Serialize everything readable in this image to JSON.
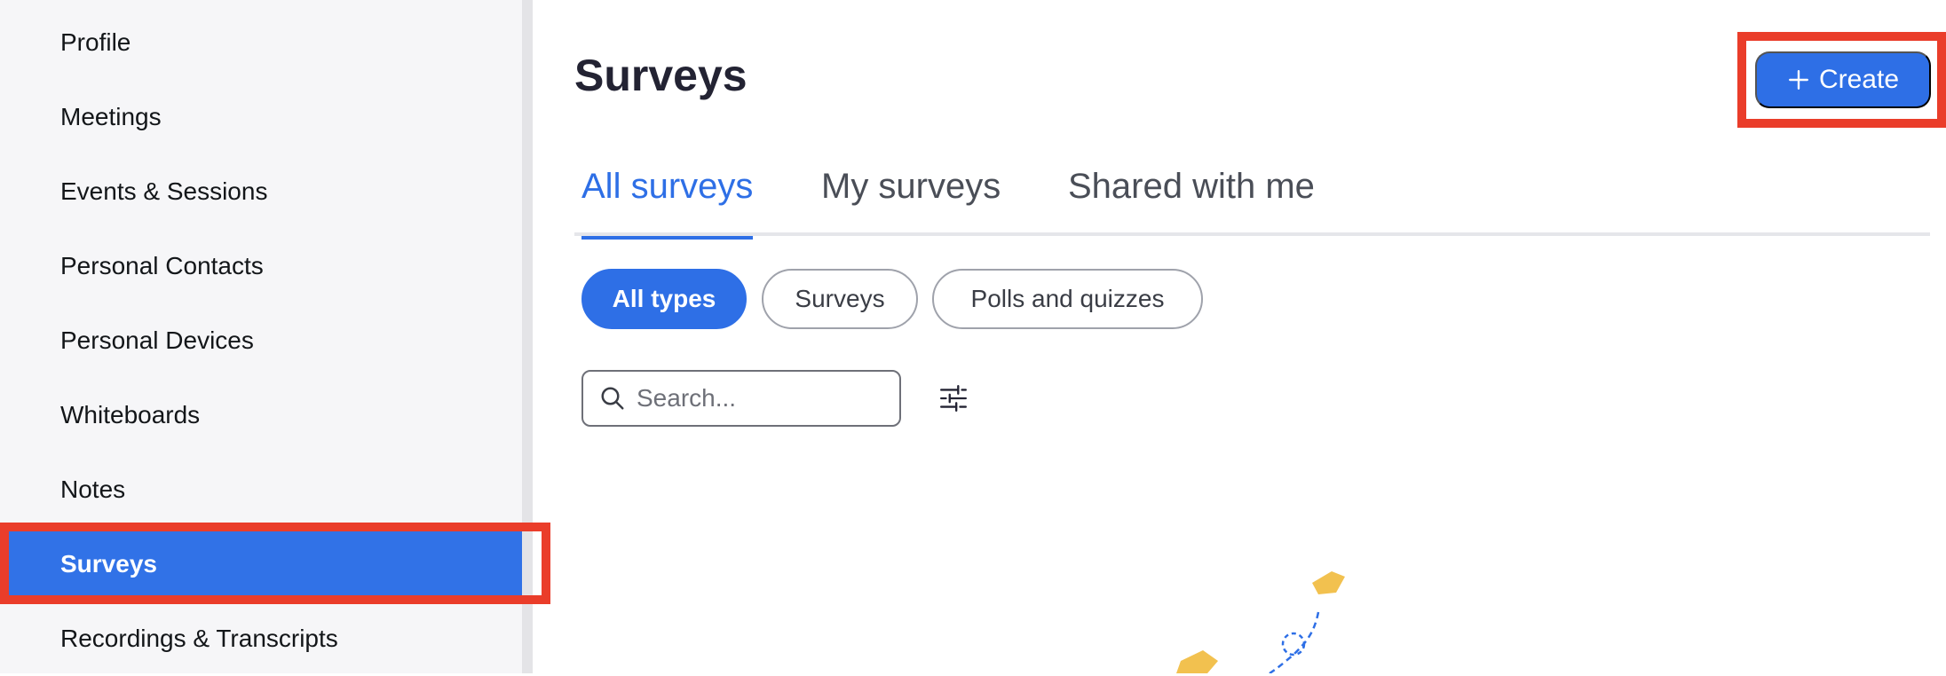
{
  "sidebar": {
    "items": [
      {
        "label": "Profile"
      },
      {
        "label": "Meetings"
      },
      {
        "label": "Events & Sessions"
      },
      {
        "label": "Personal Contacts"
      },
      {
        "label": "Personal Devices"
      },
      {
        "label": "Whiteboards"
      },
      {
        "label": "Notes"
      },
      {
        "label": "Surveys",
        "active": true
      },
      {
        "label": "Recordings & Transcripts"
      }
    ]
  },
  "header": {
    "title": "Surveys",
    "create_label": "Create",
    "create_icon": "plus-icon"
  },
  "tabs": [
    {
      "label": "All surveys",
      "active": true
    },
    {
      "label": "My surveys"
    },
    {
      "label": "Shared with me"
    }
  ],
  "chips": [
    {
      "label": "All types",
      "active": true
    },
    {
      "label": "Surveys"
    },
    {
      "label": "Polls and quizzes"
    }
  ],
  "search": {
    "placeholder": "Search...",
    "value": ""
  },
  "icons": {
    "search": "search-icon",
    "filter": "filter-sliders-icon",
    "illustration": "empty-state-illustration"
  },
  "colors": {
    "accent": "#2e6fe6",
    "sidebar_active": "#3172e7",
    "highlight": "#ea3d2a",
    "sidebar_bg": "#f6f6f8"
  }
}
